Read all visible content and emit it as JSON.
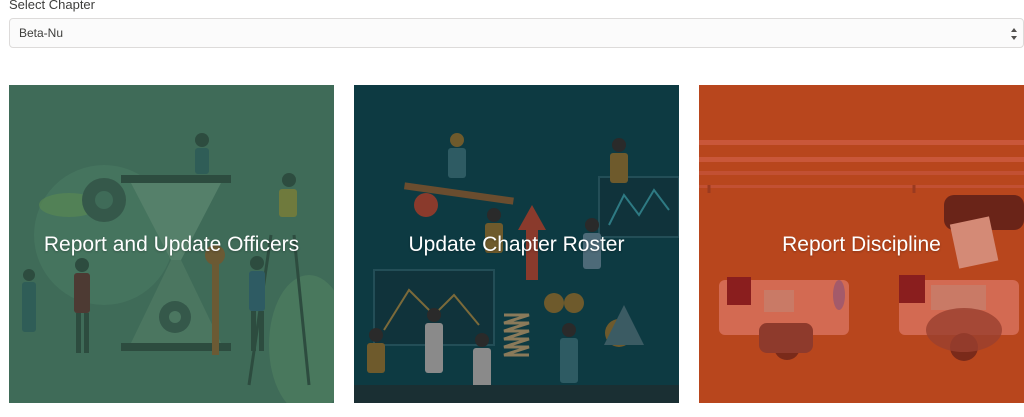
{
  "chapter_select": {
    "label": "Select Chapter",
    "value": "Beta-Nu"
  },
  "tiles": [
    {
      "title": "Report and Update Officers",
      "color": "#3f6b58"
    },
    {
      "title": "Update Chapter Roster",
      "color": "#0d3a42"
    },
    {
      "title": "Report Discipline",
      "color": "#b8461d"
    }
  ]
}
